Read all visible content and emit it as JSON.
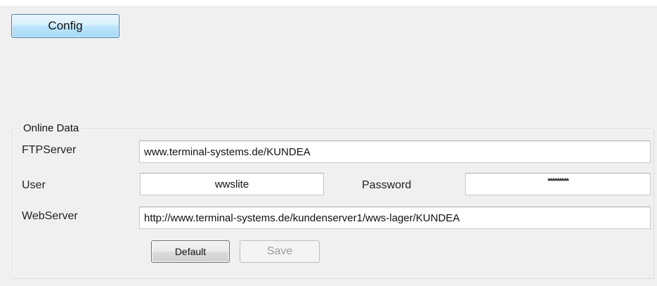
{
  "toolbar": {
    "config_label": "Config"
  },
  "online_data": {
    "group_title": "Online Data",
    "ftp_server": {
      "label": "FTPServer",
      "value": "www.terminal-systems.de/KUNDEA"
    },
    "user": {
      "label": "User",
      "value": "wwslite"
    },
    "password": {
      "label": "Password",
      "value": "*********"
    },
    "web_server": {
      "label": "WebServer",
      "value": "http://www.terminal-systems.de/kundenserver1/wws-lager/KUNDEA"
    },
    "default_label": "Default",
    "save_label": "Save",
    "save_enabled": false
  }
}
